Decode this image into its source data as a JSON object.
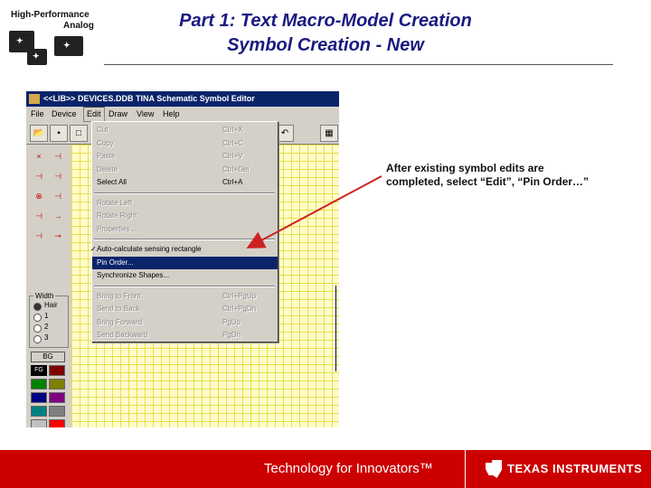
{
  "logo": {
    "line1": "High-Performance",
    "line2": "Analog"
  },
  "slide": {
    "title_line1": "Part 1: Text Macro-Model Creation",
    "title_line2": "Symbol Creation - New"
  },
  "window": {
    "title": "<<LIB>> DEVICES.DDB   TINA Schematic Symbol Editor",
    "menus": [
      "File",
      "Device",
      "Edit",
      "Draw",
      "View",
      "Help"
    ],
    "active_menu": "Edit"
  },
  "edit_menu": {
    "items": [
      {
        "label": "Cut",
        "shortcut": "Ctrl+X",
        "enabled": false
      },
      {
        "label": "Copy",
        "shortcut": "Ctrl+C",
        "enabled": false
      },
      {
        "label": "Paste",
        "shortcut": "Ctrl+V",
        "enabled": false
      },
      {
        "label": "Delete",
        "shortcut": "Ctrl+Del",
        "enabled": false
      },
      {
        "label": "Select All",
        "shortcut": "Ctrl+A",
        "enabled": true
      },
      {
        "label": "Rotate Left",
        "shortcut": "",
        "enabled": false
      },
      {
        "label": "Rotate Right",
        "shortcut": "",
        "enabled": false
      },
      {
        "label": "Properties ...",
        "shortcut": "",
        "enabled": false
      },
      {
        "label": "Auto-calculate sensing rectangle",
        "shortcut": "",
        "enabled": true,
        "checked": true
      },
      {
        "label": "Pin Order...",
        "shortcut": "",
        "enabled": true,
        "selected": true
      },
      {
        "label": "Synchronize Shapes...",
        "shortcut": "",
        "enabled": true
      },
      {
        "label": "Bring to Front",
        "shortcut": "Ctrl+PgUp",
        "enabled": false
      },
      {
        "label": "Send to Back",
        "shortcut": "Ctrl+PgDn",
        "enabled": false
      },
      {
        "label": "Bring Forward",
        "shortcut": "PgUp",
        "enabled": false
      },
      {
        "label": "Send Backward",
        "shortcut": "PgDn",
        "enabled": false
      }
    ]
  },
  "width_panel": {
    "label": "Width",
    "options": [
      "Hair",
      "1",
      "2",
      "3"
    ],
    "selected": "Hair"
  },
  "palette": {
    "bg_label": "BG",
    "fg_label": "FG",
    "colors": [
      "#800000",
      "#008000",
      "#808000",
      "#000080",
      "#800080",
      "#008080",
      "#808080",
      "#c0c0c0",
      "#ff0000",
      "#00ff00",
      "#ffff00",
      "#0000ff",
      "#ff00ff",
      "#00ffff",
      "#ffffff"
    ]
  },
  "annotation": {
    "text": "After existing symbol edits are completed, select “Edit”, “Pin Order…”"
  },
  "footer": {
    "tagline": "Technology for Innovators™",
    "brand": "TEXAS INSTRUMENTS"
  },
  "colors": {
    "footer_red": "#cc0000",
    "title_blue": "#1a1a80",
    "selection": "#0a246a",
    "grid_bg": "#fffccc"
  }
}
